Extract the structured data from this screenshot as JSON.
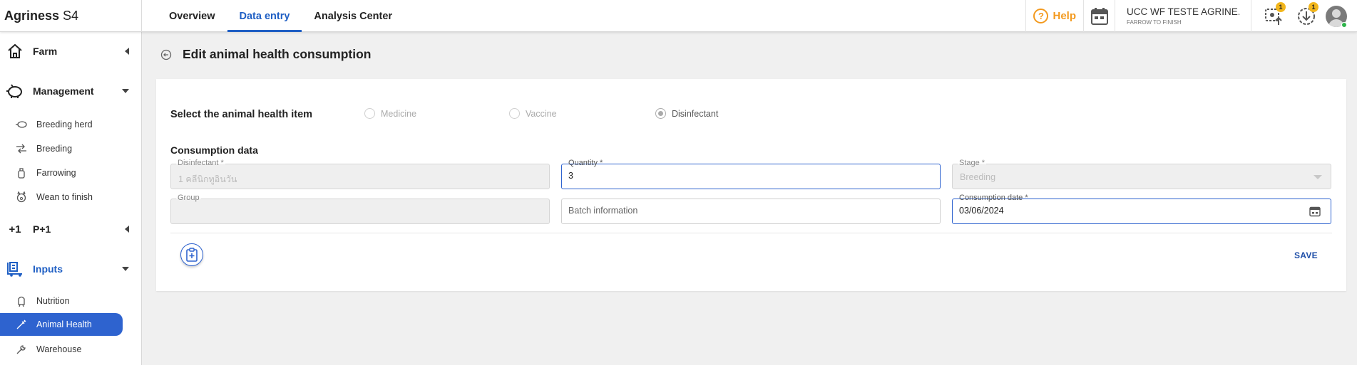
{
  "brand": {
    "name": "Agriness",
    "suffix": "S4"
  },
  "nav_tabs": [
    {
      "label": "Overview",
      "active": false
    },
    {
      "label": "Data entry",
      "active": true
    },
    {
      "label": "Analysis Center",
      "active": false
    }
  ],
  "header": {
    "help_label": "Help",
    "farm_name": "UCC WF TESTE AGRINE...",
    "farm_subtitle": "FARROW TO FINISH",
    "upload_badge": "1",
    "download_badge": "1"
  },
  "sidebar": {
    "farm": {
      "label": "Farm"
    },
    "management": {
      "label": "Management",
      "items": [
        {
          "label": "Breeding herd",
          "icon": "pig-icon"
        },
        {
          "label": "Breeding",
          "icon": "breeding-icon"
        },
        {
          "label": "Farrowing",
          "icon": "bottle-icon"
        },
        {
          "label": "Wean to finish",
          "icon": "piglet-icon"
        }
      ]
    },
    "p1": {
      "label": "P+1"
    },
    "inputs": {
      "label": "Inputs",
      "items": [
        {
          "label": "Nutrition",
          "icon": "silo-icon"
        },
        {
          "label": "Animal Health",
          "icon": "syringe-icon",
          "active": true
        },
        {
          "label": "Warehouse",
          "icon": "wrench-icon"
        }
      ]
    }
  },
  "page": {
    "title": "Edit animal health consumption",
    "select_label": "Select the animal health item",
    "radios": [
      {
        "label": "Medicine",
        "checked": false
      },
      {
        "label": "Vaccine",
        "checked": false
      },
      {
        "label": "Disinfectant",
        "checked": true
      }
    ],
    "consumption_title": "Consumption data",
    "fields": {
      "disinfectant": {
        "label": "Disinfectant *",
        "value": "1 คลีนิกทูอินวัน"
      },
      "quantity": {
        "label": "Quantity *",
        "value": "3"
      },
      "stage": {
        "label": "Stage *",
        "value": "Breeding"
      },
      "group": {
        "label": "Group",
        "value": ""
      },
      "batch": {
        "placeholder": "Batch information"
      },
      "date": {
        "label": "Consumption date *",
        "value": "03/06/2024"
      }
    },
    "save_label": "SAVE"
  },
  "colors": {
    "accent": "#2e63cf",
    "help": "#f39a1f",
    "badge": "#f2b61c"
  }
}
